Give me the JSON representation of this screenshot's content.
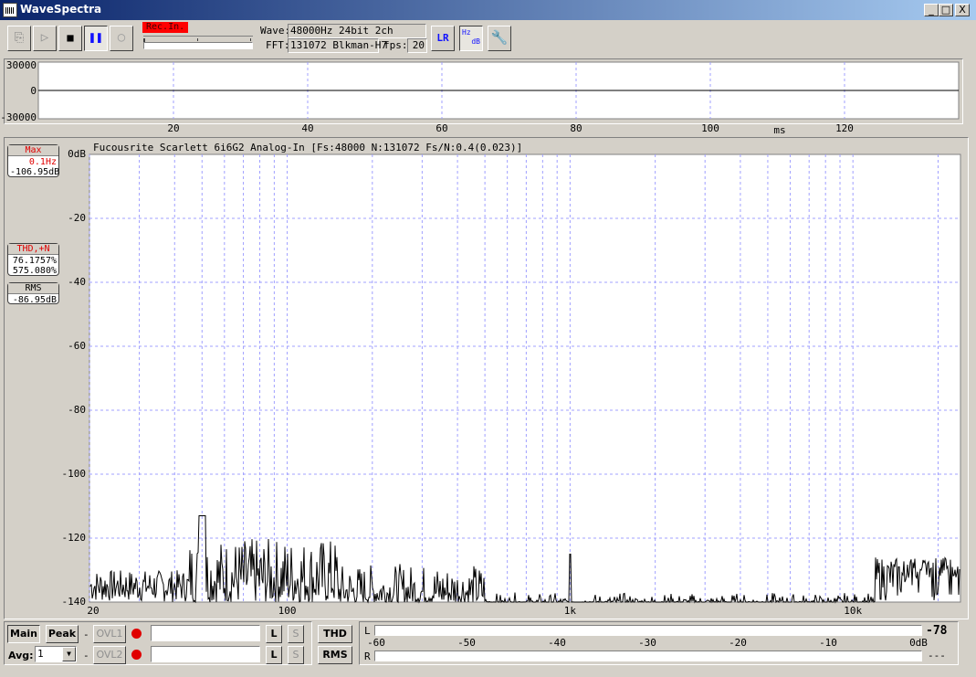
{
  "window": {
    "title": "WaveSpectra",
    "minimize": "_",
    "maximize": "□",
    "close": "X"
  },
  "toolbar": {
    "rec_in_label": "Rec.In.",
    "wave_label": "Wave:",
    "wave_value": "48000Hz 24bit 2ch",
    "fft_label": "FFT:",
    "fft_value": "131072 Blkman-H7",
    "fps_label": "fps:",
    "fps_value": "20",
    "lr_icon_label": "LR",
    "hz_db_icon_top": "Hz",
    "hz_db_icon_bottom": "dB"
  },
  "waveform": {
    "y_labels": [
      "30000",
      "0",
      "-30000"
    ],
    "x_labels": [
      "20",
      "40",
      "60",
      "80",
      "100",
      "120"
    ],
    "x_unit": "ms"
  },
  "spectrum": {
    "header": "Fucousrite Scarlett 6i6G2 Analog-In  [Fs:48000 N:131072 Fs/N:0.4(0.023)]",
    "y_labels": [
      "0dB",
      "-20",
      "-40",
      "-60",
      "-80",
      "-100",
      "-120",
      "-140"
    ],
    "x_labels": [
      "20",
      "100",
      "1k",
      "10k"
    ]
  },
  "metrics": {
    "max": {
      "title": "Max",
      "freq": "0.1Hz",
      "level": "-106.95dB"
    },
    "thd": {
      "title": "THD,+N",
      "value1": "76.1757%",
      "value2": "575.080%"
    },
    "rms": {
      "title": "RMS",
      "value": "-86.95dB"
    }
  },
  "bottom": {
    "main_label": "Main",
    "peak_label": "Peak",
    "dash": "-",
    "ovl1_label": "OVL1",
    "ovl2_label": "OVL2",
    "avg_label": "Avg:",
    "avg_value": "1",
    "l_label": "L",
    "s_label": "S",
    "thd_label": "THD",
    "rms_label": "RMS",
    "meter_l_label": "L",
    "meter_r_label": "R",
    "meter_scale": [
      "-60",
      "-50",
      "-40",
      "-30",
      "-20",
      "-10",
      "0dB"
    ],
    "meter_l_value": "-78",
    "meter_r_value": "---"
  },
  "colors": {
    "rec_in_bg": "#ff0000",
    "grid": "#a0a0ff",
    "metric_red": "#e00000",
    "accent_blue": "#1010ff"
  }
}
